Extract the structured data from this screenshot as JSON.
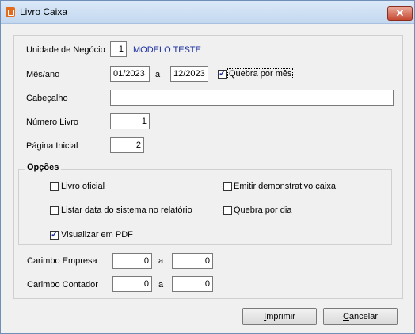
{
  "window": {
    "title": "Livro Caixa",
    "close_glyph": "✕"
  },
  "form": {
    "unidade_label": "Unidade de Negócio",
    "unidade_value": "1",
    "unidade_name": "MODELO TESTE",
    "mes_label": "Mês/ano",
    "mes_from": "01/2023",
    "mes_sep": "a",
    "mes_to": "12/2023",
    "quebra_mes_label": "Quebra por mês",
    "quebra_mes_checked": true,
    "cabecalho_label": "Cabeçalho",
    "cabecalho_value": "",
    "numero_label": "Número Livro",
    "numero_value": "1",
    "pagina_label": "Página Inicial",
    "pagina_value": "2"
  },
  "opcoes": {
    "title": "Opções",
    "livro_oficial": {
      "label": "Livro oficial",
      "checked": false
    },
    "emitir_demo": {
      "label": "Emitir demonstrativo caixa",
      "checked": false
    },
    "listar_data": {
      "label": "Listar data do sistema no relatório",
      "checked": false
    },
    "quebra_dia": {
      "label": "Quebra por dia",
      "checked": false
    },
    "visualizar_pdf": {
      "label": "Visualizar em PDF",
      "checked": true
    }
  },
  "carimbo": {
    "empresa_label": "Carimbo Empresa",
    "empresa_from": "0",
    "empresa_sep": "a",
    "empresa_to": "0",
    "contador_label": "Carimbo Contador",
    "contador_from": "0",
    "contador_sep": "a",
    "contador_to": "0"
  },
  "buttons": {
    "imprimir_first": "I",
    "imprimir_rest": "mprimir",
    "cancelar_first": "C",
    "cancelar_rest": "ancelar"
  },
  "colors": {
    "accent_text": "#1b2f9f",
    "close_red": "#c74a33"
  }
}
